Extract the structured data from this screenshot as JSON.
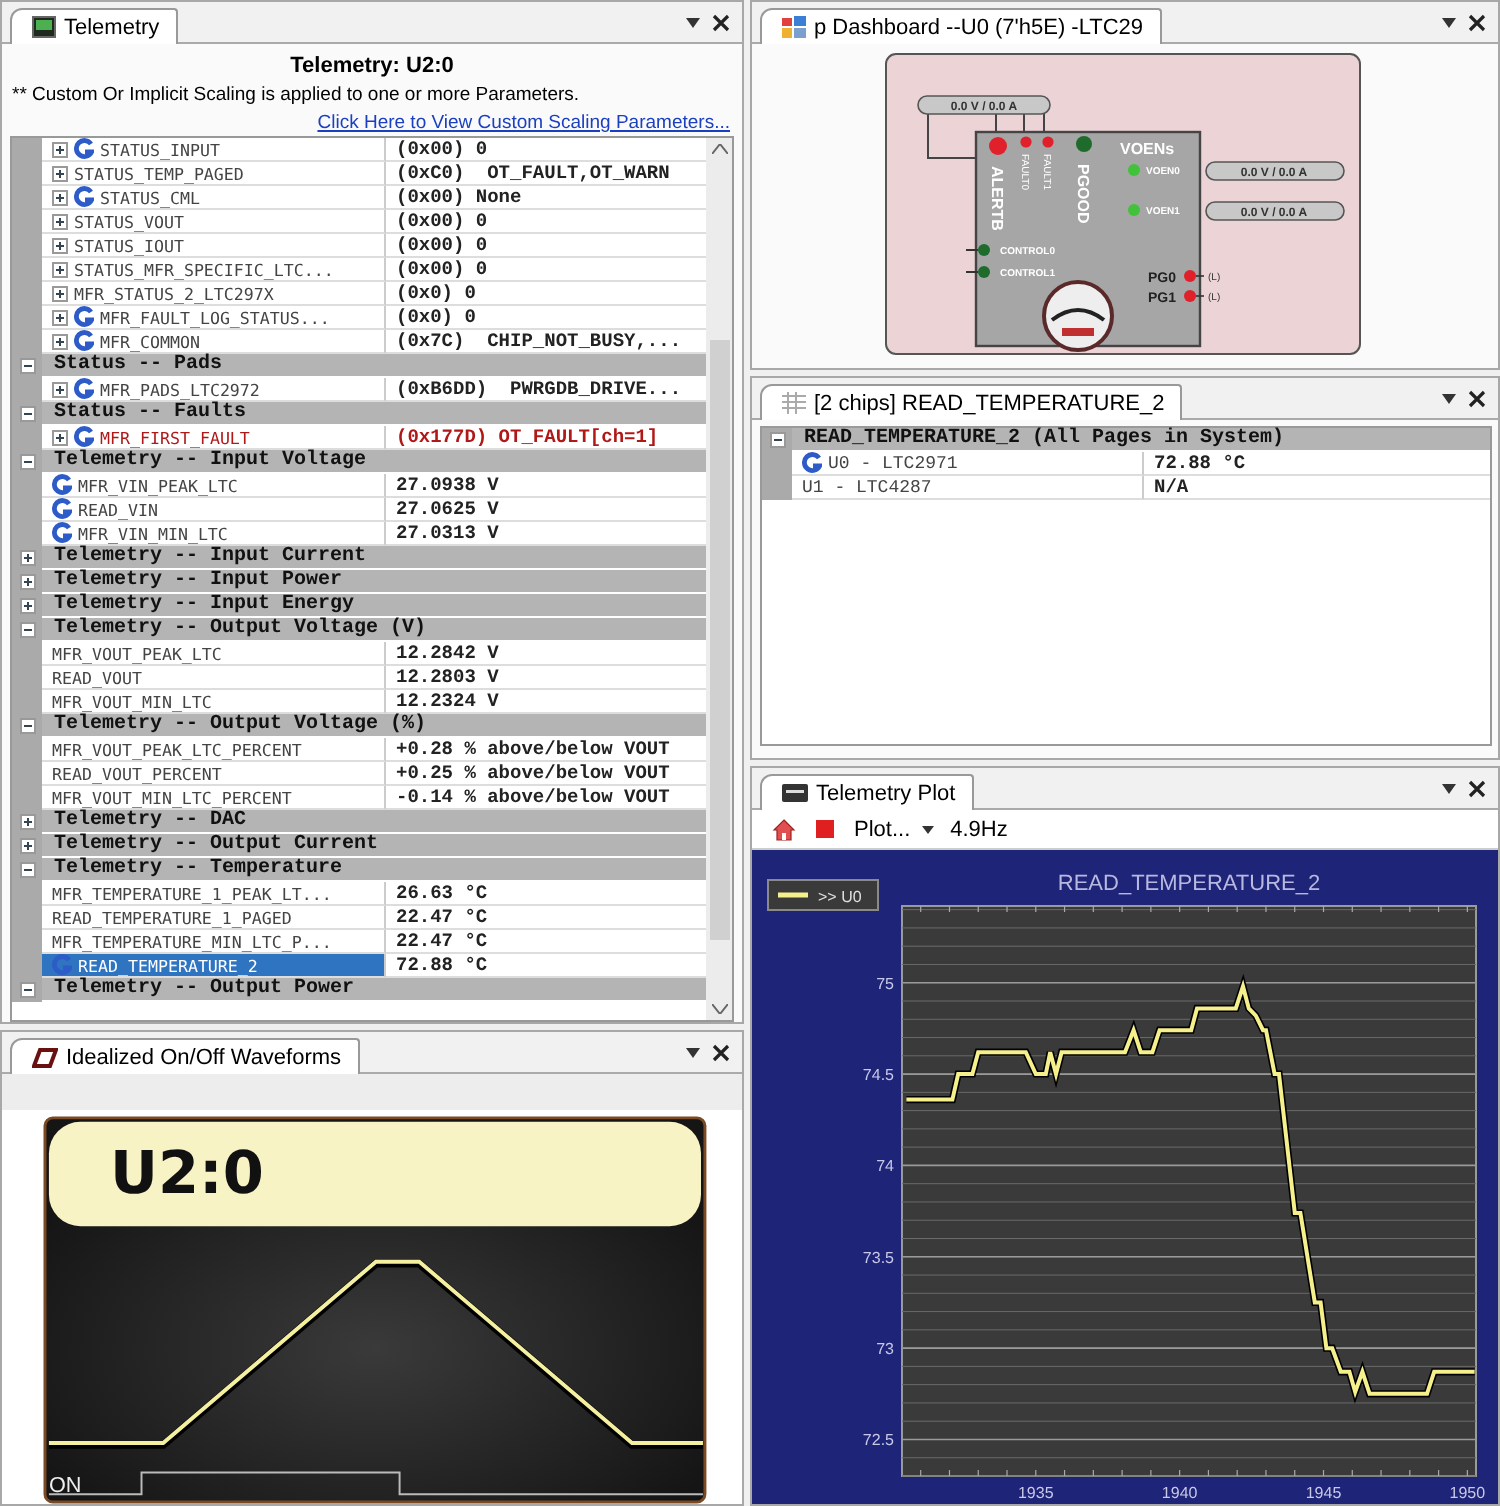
{
  "telemetry_panel": {
    "tab": "Telemetry",
    "title": "Telemetry: U2:0",
    "note": "** Custom Or Implicit Scaling is applied to one or more Parameters.",
    "link": "Click Here to View Custom Scaling Parameters...",
    "rows": [
      {
        "kind": "param",
        "name": "STATUS_INPUT",
        "value": "(0x00) 0",
        "expandable": true,
        "g_badge": true,
        "fault": false,
        "selected": false
      },
      {
        "kind": "param",
        "name": "STATUS_TEMP_PAGED",
        "value": "(0xC0)  OT_FAULT,OT_WARN",
        "expandable": true,
        "g_badge": false,
        "fault": false,
        "selected": false
      },
      {
        "kind": "param",
        "name": "STATUS_CML",
        "value": "(0x00) None",
        "expandable": true,
        "g_badge": true,
        "fault": false,
        "selected": false
      },
      {
        "kind": "param",
        "name": "STATUS_VOUT",
        "value": "(0x00) 0",
        "expandable": true,
        "g_badge": false,
        "fault": false,
        "selected": false
      },
      {
        "kind": "param",
        "name": "STATUS_IOUT",
        "value": "(0x00) 0",
        "expandable": true,
        "g_badge": false,
        "fault": false,
        "selected": false
      },
      {
        "kind": "param",
        "name": "STATUS_MFR_SPECIFIC_LTC...",
        "value": "(0x00) 0",
        "expandable": true,
        "g_badge": false,
        "fault": false,
        "selected": false
      },
      {
        "kind": "param",
        "name": "MFR_STATUS_2_LTC297X",
        "value": "(0x0) 0",
        "expandable": true,
        "g_badge": false,
        "fault": false,
        "selected": false
      },
      {
        "kind": "param",
        "name": "MFR_FAULT_LOG_STATUS...",
        "value": "(0x0) 0",
        "expandable": true,
        "g_badge": true,
        "fault": false,
        "selected": false
      },
      {
        "kind": "param",
        "name": "MFR_COMMON",
        "value": "(0x7C)  CHIP_NOT_BUSY,...",
        "expandable": true,
        "g_badge": true,
        "fault": false,
        "selected": false
      },
      {
        "kind": "group",
        "label": "Status -- Pads",
        "expanded": true,
        "children": [
          {
            "kind": "param",
            "name": "MFR_PADS_LTC2972",
            "value": "(0xB6DD)  PWRGDB_DRIVE...",
            "expandable": true,
            "g_badge": true,
            "fault": false,
            "selected": false
          }
        ]
      },
      {
        "kind": "group",
        "label": "Status -- Faults",
        "expanded": true,
        "children": [
          {
            "kind": "param",
            "name": "MFR_FIRST_FAULT",
            "value": "(0x177D) OT_FAULT[ch=1]",
            "expandable": true,
            "g_badge": true,
            "fault": true,
            "selected": false
          }
        ]
      },
      {
        "kind": "group",
        "label": "Telemetry -- Input Voltage",
        "expanded": true,
        "children": [
          {
            "kind": "param",
            "name": "MFR_VIN_PEAK_LTC",
            "value": "27.0938 V",
            "expandable": false,
            "g_badge": true,
            "fault": false,
            "selected": false
          },
          {
            "kind": "param",
            "name": "READ_VIN",
            "value": "27.0625 V",
            "expandable": false,
            "g_badge": true,
            "fault": false,
            "selected": false
          },
          {
            "kind": "param",
            "name": "MFR_VIN_MIN_LTC",
            "value": "27.0313 V",
            "expandable": false,
            "g_badge": true,
            "fault": false,
            "selected": false
          }
        ]
      },
      {
        "kind": "group",
        "label": "Telemetry -- Input Current",
        "expanded": false,
        "children": []
      },
      {
        "kind": "group",
        "label": "Telemetry -- Input Power",
        "expanded": false,
        "children": []
      },
      {
        "kind": "group",
        "label": "Telemetry -- Input Energy",
        "expanded": false,
        "children": []
      },
      {
        "kind": "group",
        "label": "Telemetry -- Output Voltage (V)",
        "expanded": true,
        "children": [
          {
            "kind": "param",
            "name": "MFR_VOUT_PEAK_LTC",
            "value": "12.2842 V",
            "expandable": false,
            "g_badge": false,
            "fault": false,
            "selected": false
          },
          {
            "kind": "param",
            "name": "READ_VOUT",
            "value": "12.2803 V",
            "expandable": false,
            "g_badge": false,
            "fault": false,
            "selected": false
          },
          {
            "kind": "param",
            "name": "MFR_VOUT_MIN_LTC",
            "value": "12.2324 V",
            "expandable": false,
            "g_badge": false,
            "fault": false,
            "selected": false
          }
        ]
      },
      {
        "kind": "group",
        "label": "Telemetry -- Output Voltage (%)",
        "expanded": true,
        "children": [
          {
            "kind": "param",
            "name": "MFR_VOUT_PEAK_LTC_PERCENT",
            "value": "+0.28 % above/below VOUT",
            "expandable": false,
            "g_badge": false,
            "fault": false,
            "selected": false
          },
          {
            "kind": "param",
            "name": "READ_VOUT_PERCENT",
            "value": "+0.25 % above/below VOUT",
            "expandable": false,
            "g_badge": false,
            "fault": false,
            "selected": false
          },
          {
            "kind": "param",
            "name": "MFR_VOUT_MIN_LTC_PERCENT",
            "value": "-0.14 % above/below VOUT",
            "expandable": false,
            "g_badge": false,
            "fault": false,
            "selected": false
          }
        ]
      },
      {
        "kind": "group",
        "label": "Telemetry -- DAC",
        "expanded": false,
        "children": []
      },
      {
        "kind": "group",
        "label": "Telemetry -- Output Current",
        "expanded": false,
        "children": []
      },
      {
        "kind": "group",
        "label": "Telemetry -- Temperature",
        "expanded": true,
        "children": [
          {
            "kind": "param",
            "name": "MFR_TEMPERATURE_1_PEAK_LT...",
            "value": "26.63 °C",
            "expandable": false,
            "g_badge": false,
            "fault": false,
            "selected": false
          },
          {
            "kind": "param",
            "name": "READ_TEMPERATURE_1_PAGED",
            "value": "22.47 °C",
            "expandable": false,
            "g_badge": false,
            "fault": false,
            "selected": false
          },
          {
            "kind": "param",
            "name": "MFR_TEMPERATURE_MIN_LTC_P...",
            "value": "22.47 °C",
            "expandable": false,
            "g_badge": false,
            "fault": false,
            "selected": false
          },
          {
            "kind": "param",
            "name": "READ_TEMPERATURE_2",
            "value": "72.88 °C",
            "expandable": false,
            "g_badge": true,
            "fault": false,
            "selected": true
          }
        ]
      },
      {
        "kind": "group",
        "label": "Telemetry -- Output Power",
        "expanded": true,
        "children": []
      }
    ]
  },
  "waveform_panel": {
    "tab": "Idealized On/Off Waveforms",
    "rail": "U2:0",
    "signal_label": "ON"
  },
  "dashboard_panel": {
    "tab": "p Dashboard --U0 (7'h5E) -LTC29",
    "input_readout": "0.0 V / 0.0 A",
    "voens_title": "VOENs",
    "pins": [
      {
        "kind": "alert",
        "label": "ALERTB",
        "color": "#e0202a"
      },
      {
        "kind": "fault",
        "label": "FAULT0",
        "color": "#e0202a"
      },
      {
        "kind": "fault",
        "label": "FAULT1",
        "color": "#e0202a"
      },
      {
        "kind": "pgood",
        "label": "PGOOD",
        "color": "#1e6b2c"
      },
      {
        "kind": "voen",
        "label": "VOEN0",
        "color": "#42c23a",
        "readout": "0.0 V / 0.0 A"
      },
      {
        "kind": "voen",
        "label": "VOEN1",
        "color": "#42c23a",
        "readout": "0.0 V / 0.0 A"
      },
      {
        "kind": "control",
        "label": "CONTROL0",
        "color": "#1e6b2c"
      },
      {
        "kind": "control",
        "label": "CONTROL1",
        "color": "#1e6b2c"
      },
      {
        "kind": "pg",
        "label": "PG0",
        "color": "#e0202a",
        "state": "(L)"
      },
      {
        "kind": "pg",
        "label": "PG1",
        "color": "#e0202a",
        "state": "(L)"
      }
    ]
  },
  "chips_panel": {
    "tab": "[2 chips] READ_TEMPERATURE_2",
    "group": "READ_TEMPERATURE_2 (All Pages in System)",
    "expanded": true,
    "rows": [
      {
        "name": "U0 - LTC2971",
        "value": "72.88 °C",
        "g_badge": true
      },
      {
        "name": "U1 - LTC4287",
        "value": "N/A",
        "g_badge": false
      }
    ]
  },
  "plot_panel": {
    "tab": "Telemetry Plot",
    "plot_menu": "Plot...",
    "rate": "4.9Hz",
    "chart_data": {
      "type": "line",
      "title": "READ_TEMPERATURE_2",
      "x": [
        1930.5,
        1932.1,
        1932.3,
        1932.8,
        1933.0,
        1934.65,
        1935.0,
        1935.35,
        1935.5,
        1935.7,
        1935.9,
        1938.1,
        1938.4,
        1938.65,
        1939.05,
        1939.3,
        1940.4,
        1940.6,
        1941.95,
        1942.2,
        1942.4,
        1942.65,
        1942.9,
        1943.0,
        1943.3,
        1943.45,
        1944.0,
        1944.2,
        1944.7,
        1944.9,
        1945.1,
        1945.3,
        1945.6,
        1945.9,
        1946.1,
        1946.35,
        1946.6,
        1948.6,
        1948.85,
        1950.25
      ],
      "series": [
        {
          "name": ">> U0",
          "color": "#f5f08c",
          "values": [
            74.36,
            74.36,
            74.5,
            74.5,
            74.62,
            74.62,
            74.5,
            74.5,
            74.62,
            74.5,
            74.62,
            74.62,
            74.74,
            74.62,
            74.62,
            74.74,
            74.74,
            74.86,
            74.86,
            74.98,
            74.86,
            74.82,
            74.74,
            74.74,
            74.5,
            74.5,
            73.74,
            73.74,
            73.25,
            73.25,
            73.0,
            73.0,
            72.87,
            72.87,
            72.76,
            72.87,
            72.75,
            72.75,
            72.87,
            72.87
          ]
        }
      ],
      "grid": true,
      "xlim": [
        1930.35,
        1950.3
      ],
      "ylim": [
        72.3,
        75.42
      ],
      "xticks": [
        1935,
        1940,
        1945,
        1950
      ],
      "yticks": [
        72.5,
        73,
        73.5,
        74,
        74.5,
        75
      ]
    }
  }
}
